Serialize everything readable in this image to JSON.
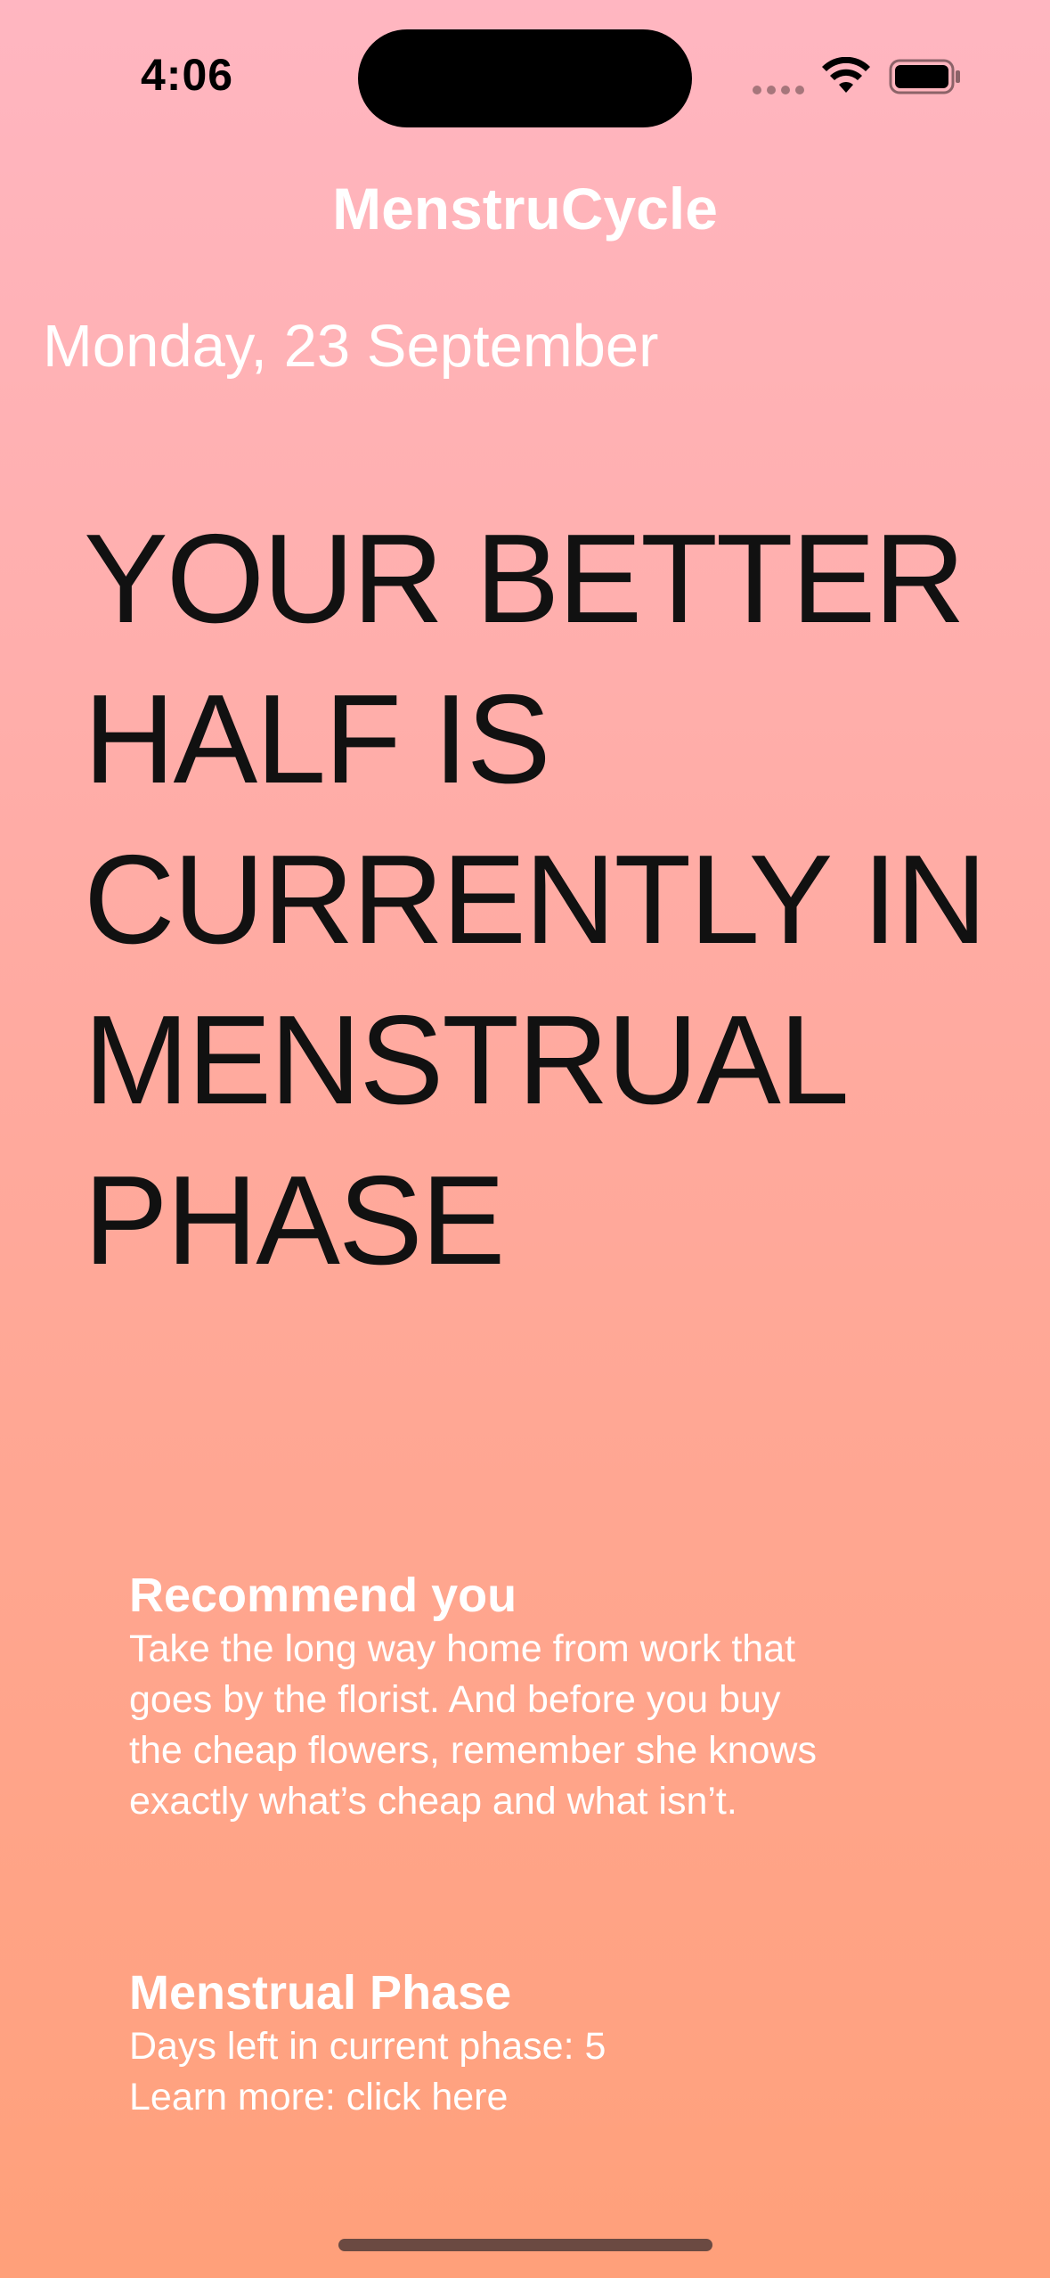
{
  "status_bar": {
    "time": "4:06"
  },
  "nav": {
    "title": "MenstruCycle"
  },
  "date": "Monday, 23 September",
  "headline": {
    "lines": [
      "YOUR BETTER",
      "HALF IS",
      "CURRENTLY IN",
      "MENSTRUAL",
      "PHASE"
    ]
  },
  "recommendation": {
    "title": "Recommend you",
    "lines": [
      "Take the long way home from work that",
      "goes by the florist. And before you buy",
      "the cheap flowers, remember she knows",
      "exactly what’s cheap and what isn’t."
    ]
  },
  "phase_info": {
    "title": "Menstrual Phase",
    "days_left": "Days left in current phase: 5",
    "learn_more": "Learn more: click here"
  },
  "colors": {
    "gradient_top": "#ffb6c1",
    "gradient_bottom": "#ffa07a",
    "headline_text": "#111111",
    "text": "#ffffff"
  },
  "icons": [
    "signal-icon",
    "wifi-icon",
    "battery-icon"
  ]
}
